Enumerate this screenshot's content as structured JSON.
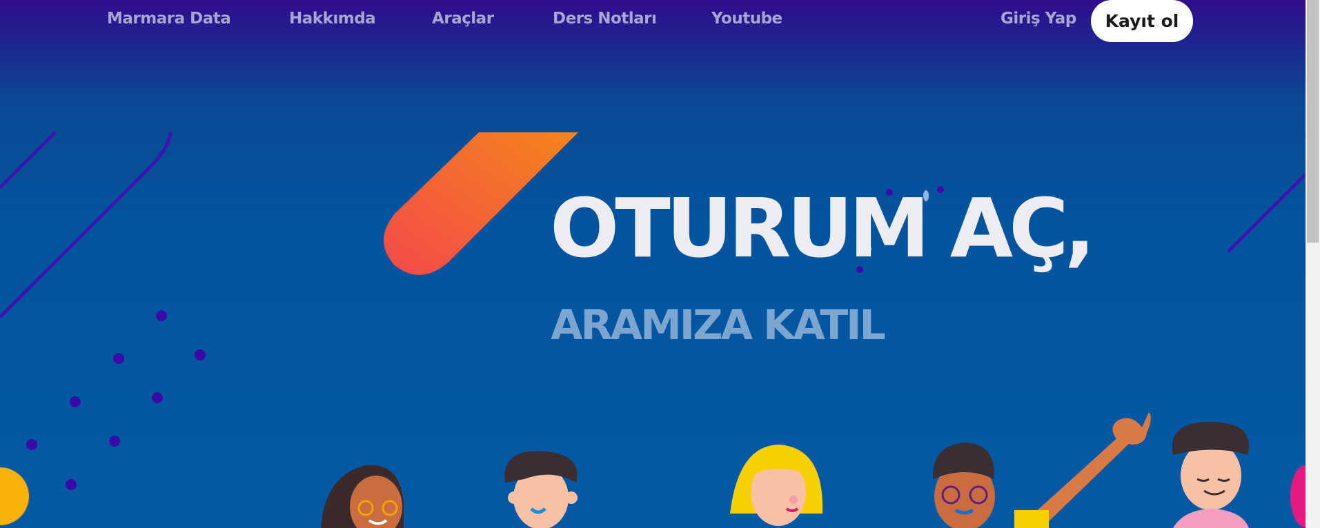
{
  "nav": {
    "links": [
      "Marmara Data",
      "Hakkımda",
      "Araçlar",
      "Ders Notları",
      "Youtube"
    ],
    "login": "Giriş Yap",
    "signup": "Kayıt ol"
  },
  "hero": {
    "title": "OTURUM AÇ,",
    "subtitle": "ARAMIZA KATIL"
  },
  "colors": {
    "nav_bg": "#300c8c",
    "hero_bg": "#0459a5",
    "accent_orange": "#f47a20",
    "accent_red": "#f4494a",
    "dot_purple": "#3a0aa8"
  }
}
